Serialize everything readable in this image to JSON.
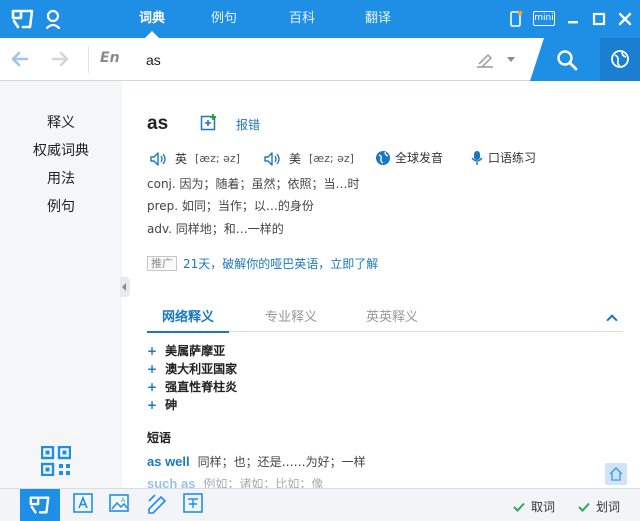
{
  "titlebar": {
    "tabs": [
      {
        "label": "词典",
        "active": true
      },
      {
        "label": "例句",
        "active": false
      },
      {
        "label": "百科",
        "active": false
      },
      {
        "label": "翻译",
        "active": false
      }
    ],
    "mini_label": "mini"
  },
  "search": {
    "lang": "En",
    "value": "as"
  },
  "sidebar": {
    "items": [
      "释义",
      "权威词典",
      "用法",
      "例句"
    ]
  },
  "entry": {
    "word": "as",
    "report_label": "报错",
    "pron_uk_label": "英",
    "pron_uk": "[æz; əz]",
    "pron_us_label": "美",
    "pron_us": "[æz; əz]",
    "global_pron_label": "全球发音",
    "oral_practice_label": "口语练习",
    "definitions": [
      "conj. 因为；随着；虽然；依照；当…时",
      "prep. 如同；当作；以…的身份",
      "adv. 同样地；和…一样的"
    ],
    "promo_tag": "推广",
    "promo_text": "21天，破解你的哑巴英语，立即了解"
  },
  "tabs": [
    {
      "label": "网络释义",
      "active": true
    },
    {
      "label": "专业释义",
      "active": false
    },
    {
      "label": "英英释义",
      "active": false
    }
  ],
  "net_items": [
    "美属萨摩亚",
    "澳大利亚国家",
    "强直性脊柱炎",
    "砷"
  ],
  "phrases": {
    "title": "短语",
    "items": [
      {
        "en": "as well",
        "zh": "同样；也；还是……为好；一样"
      },
      {
        "en": "such as",
        "zh": "例如；诸如；比如；像"
      }
    ]
  },
  "bottom": {
    "cancel_label": "取词",
    "select_label": "划词"
  },
  "colors": {
    "accent": "#1f8fe6",
    "link": "#1a78c2"
  }
}
